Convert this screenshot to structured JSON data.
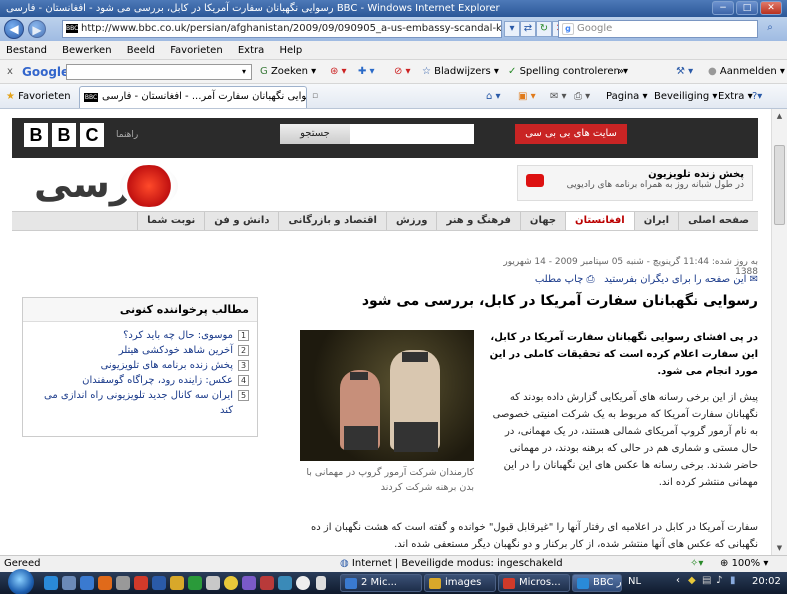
{
  "window": {
    "title": "رسوایی نگهبانان سفارت آمریکا در کابل، بررسی می شود - افغانستان - فارسی BBC - Windows Internet Explorer",
    "minimize": "−",
    "maximize": "□",
    "close": "✕"
  },
  "address": {
    "url": "http://www.bbc.co.uk/persian/afghanistan/2009/09/090905_a-us-embassy-scandal-kabul.shtml",
    "search_placeholder": "Google"
  },
  "menu": [
    "Bestand",
    "Bewerken",
    "Beeld",
    "Favorieten",
    "Extra",
    "Help"
  ],
  "google_toolbar": {
    "close": "x",
    "logo": "Google",
    "zoeken": "Zoeken",
    "bladwijzers": "Bladwijzers",
    "spelling": "Spelling controleren",
    "more": "»",
    "aanmelden": "Aanmelden"
  },
  "favorites_bar": {
    "favorieten": "Favorieten",
    "tab_title": "رسوایی نگهبانان سفارت آمر... - افغانستان - فارسی BBC",
    "pagina": "Pagina",
    "beveiliging": "Beveiliging",
    "extra": "Extra"
  },
  "bbc": {
    "logo_letters": [
      "B",
      "B",
      "C"
    ],
    "raahnama": "راهنما",
    "search_button": "جستجو",
    "site_button": "سایت های بی بی سی",
    "brand_text": "فارسی",
    "live_title": "پخش زنده تلویزیون",
    "live_sub": "در طول شبانه روز به همراه برنامه های رادیویی"
  },
  "nav": [
    "صفحه اصلی",
    "ایران",
    "افغانستان",
    "جهان",
    "فرهنگ و هنر",
    "ورزش",
    "اقتصاد و بازرگانی",
    "دانش و فن",
    "نوبت شما"
  ],
  "nav_active": 2,
  "article": {
    "dateline": "به روز شده: 11:44 گرینویچ - شنبه 05 سپتامبر 2009 - 14 شهریور 1388",
    "email_link": "این صفحه را برای دیگران بفرستید",
    "print_link": "چاپ مطلب",
    "headline": "رسوایی نگهبانان سفارت آمریکا در کابل، بررسی می شود",
    "lede": "در پی افشای رسوایی نگهبانان سفارت آمریکا در کابل، این سفارت اعلام کرده است که تحقیقات کاملی در این مورد انجام می شود.",
    "body1": "پیش از این برخی رسانه های آمریکایی گزارش داده بودند که نگهبانان سفارت آمریکا که مربوط به یک شرکت امنیتی خصوصی به نام آرمور گروپ آمریکای شمالی هستند، در یک مهمانی، در حال مستی و شماری هم در حالی که برهنه بودند، در مهمانی حاضر شدند. برخی رسانه ها عکس های این نگهبانان را در این مهمانی منتشر کرده اند.",
    "body2": "سفارت آمریکا در کابل در اعلامیه ای رفتار آنها را \"غیرقابل قبول\" خوانده و گفته است که هشت نگهبان از ده نگهبانی که عکس های آنها منتشر شده، از کار برکنار و دو نگهبان دیگر مستعفی شده اند.",
    "caption": "کارمندان شرکت آرمور گروپ در مهمانی با بدن برهنه شرکت کردند"
  },
  "sidebar": {
    "heading": "مطالب پرخواننده کنونی",
    "items": [
      {
        "num": "1",
        "text": "موسوی: حال چه باید کرد؟"
      },
      {
        "num": "2",
        "text": "آخرین شاهد خودکشی هیتلر"
      },
      {
        "num": "3",
        "text": "پخش زنده برنامه های تلویزیونی"
      },
      {
        "num": "4",
        "text": "عکس: زاینده رود، چراگاه گوسفندان"
      },
      {
        "num": "5",
        "text": "ایران سه کانال جدید تلویزیونی راه اندازی می کند"
      }
    ]
  },
  "status": {
    "left": "Gereed",
    "zone": "Internet | Beveiligde modus: ingeschakeld",
    "zoom": "100%"
  },
  "taskbar": {
    "buttons": [
      "2 Mic...",
      "images",
      "Micros...",
      "BBC فار..."
    ],
    "lang": "NL",
    "time": "20:02"
  },
  "colors": {
    "accent_red": "#c92424",
    "bbc_bar": "#2b2b2b",
    "link": "#1a3a8a",
    "title_bar": "#2b5797"
  }
}
